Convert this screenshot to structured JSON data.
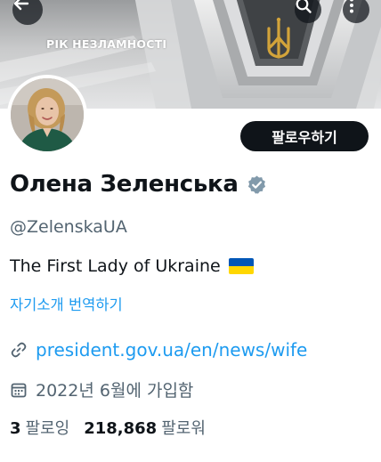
{
  "banner": {
    "text": "РІК НЕЗЛАМНОСТІ",
    "icons": {
      "back": "arrow-left-icon",
      "search": "search-icon",
      "more": "more-vertical-icon"
    }
  },
  "profile": {
    "display_name": "Олена Зеленська",
    "handle": "@ZelenskaUA",
    "bio": "The First Lady of Ukraine",
    "bio_flag": "ukraine-flag-emoji",
    "translate_label": "자기소개 번역하기",
    "website": "president.gov.ua/en/news/wife",
    "joined": "2022년 6월에 가입함",
    "following_count": "3",
    "following_label": "팔로잉",
    "followers_count": "218,868",
    "followers_label": "팔로워",
    "verified_badge": "verified-badge-icon"
  },
  "actions": {
    "follow_label": "팔로우하기"
  },
  "colors": {
    "text_primary": "#0f1419",
    "text_secondary": "#536471",
    "link": "#1d9bf0",
    "button_bg": "#0f1419",
    "verified_badge": "#829aab",
    "flag_blue": "#0057b7",
    "flag_yellow": "#ffd700"
  }
}
